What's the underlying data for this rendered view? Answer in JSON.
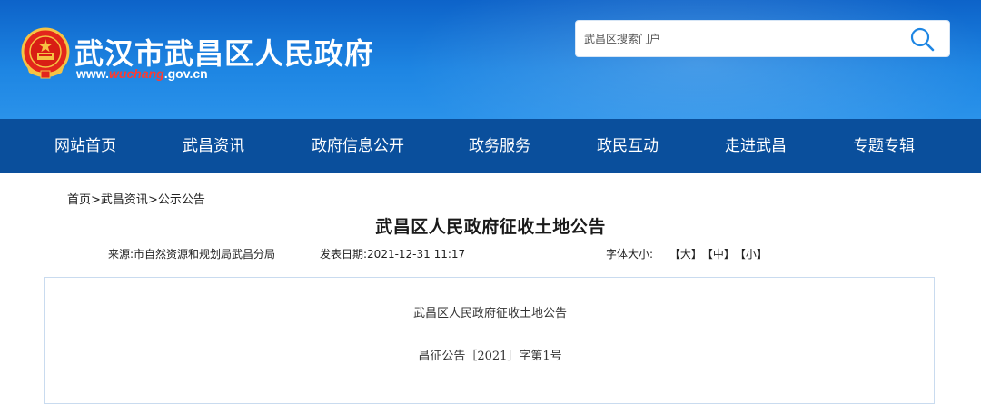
{
  "site": {
    "title": "武汉市武昌区人民政府",
    "url_prefix": "www.",
    "url_highlight": "wuchang",
    "url_suffix": ".gov.cn"
  },
  "search": {
    "placeholder": "武昌区搜索门户",
    "icon": "search-icon"
  },
  "nav": {
    "items": [
      {
        "label": "网站首页"
      },
      {
        "label": "武昌资讯"
      },
      {
        "label": "政府信息公开"
      },
      {
        "label": "政务服务"
      },
      {
        "label": "政民互动"
      },
      {
        "label": "走进武昌"
      },
      {
        "label": "专题专辑"
      }
    ]
  },
  "breadcrumb": {
    "items": [
      "首页",
      "武昌资讯",
      "公示公告"
    ],
    "separator": ">"
  },
  "article": {
    "title": "武昌区人民政府征收土地公告",
    "source": "来源:市自然资源和规划局武昌分局",
    "date": "发表日期:2021-12-31 11:17",
    "font_size_label": "字体大小:",
    "font_sizes": [
      "【大】",
      "【中】",
      "【小】"
    ],
    "body": {
      "heading": "武昌区人民政府征收土地公告",
      "doc_number": "昌征公告［2021］字第1号"
    }
  },
  "colors": {
    "header_blue": "#1e86e3",
    "nav_blue": "#0a4f9c",
    "url_highlight": "#ff3b30",
    "content_border": "#c9dbef"
  }
}
